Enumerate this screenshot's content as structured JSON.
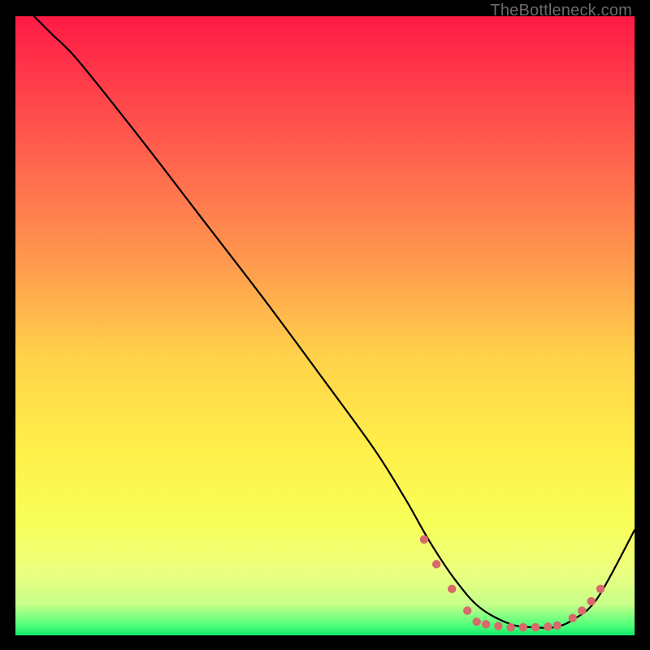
{
  "watermark": "TheBottleneck.com",
  "chart_data": {
    "type": "line",
    "title": "",
    "xlabel": "",
    "ylabel": "",
    "xlim": [
      0,
      100
    ],
    "ylim": [
      0,
      100
    ],
    "background_gradient": {
      "stops": [
        {
          "offset": 0.0,
          "color": "#ff1a45"
        },
        {
          "offset": 0.1,
          "color": "#ff3a4a"
        },
        {
          "offset": 0.25,
          "color": "#ff6a4e"
        },
        {
          "offset": 0.4,
          "color": "#ff9a4e"
        },
        {
          "offset": 0.55,
          "color": "#ffd24a"
        },
        {
          "offset": 0.7,
          "color": "#ffef4a"
        },
        {
          "offset": 0.82,
          "color": "#f8ff59"
        },
        {
          "offset": 0.9,
          "color": "#eaff80"
        },
        {
          "offset": 0.95,
          "color": "#c8ff8a"
        },
        {
          "offset": 0.985,
          "color": "#4bff7a"
        },
        {
          "offset": 1.0,
          "color": "#12e86a"
        }
      ]
    },
    "series": [
      {
        "name": "bottleneck-curve",
        "color": "#000000",
        "x": [
          3.0,
          6.0,
          10.0,
          20.0,
          30.0,
          40.0,
          50.0,
          58.0,
          63.0,
          67.0,
          71.0,
          75.0,
          80.0,
          84.0,
          87.0,
          90.0,
          94.0,
          100.0
        ],
        "y": [
          100.0,
          97.0,
          93.0,
          80.5,
          67.5,
          54.5,
          41.0,
          30.0,
          22.0,
          15.0,
          9.0,
          4.5,
          1.8,
          1.3,
          1.3,
          2.5,
          6.0,
          17.0
        ]
      }
    ],
    "markers": {
      "name": "highlighted-points",
      "color": "#d86a6a",
      "points": [
        {
          "x": 66.0,
          "y": 15.5
        },
        {
          "x": 68.0,
          "y": 11.5
        },
        {
          "x": 70.5,
          "y": 7.5
        },
        {
          "x": 73.0,
          "y": 4.0
        },
        {
          "x": 74.5,
          "y": 2.2
        },
        {
          "x": 76.0,
          "y": 1.8
        },
        {
          "x": 78.0,
          "y": 1.5
        },
        {
          "x": 80.0,
          "y": 1.3
        },
        {
          "x": 82.0,
          "y": 1.3
        },
        {
          "x": 84.0,
          "y": 1.3
        },
        {
          "x": 86.0,
          "y": 1.4
        },
        {
          "x": 87.5,
          "y": 1.6
        },
        {
          "x": 90.0,
          "y": 2.8
        },
        {
          "x": 91.5,
          "y": 4.0
        },
        {
          "x": 93.0,
          "y": 5.5
        },
        {
          "x": 94.5,
          "y": 7.5
        }
      ]
    }
  }
}
